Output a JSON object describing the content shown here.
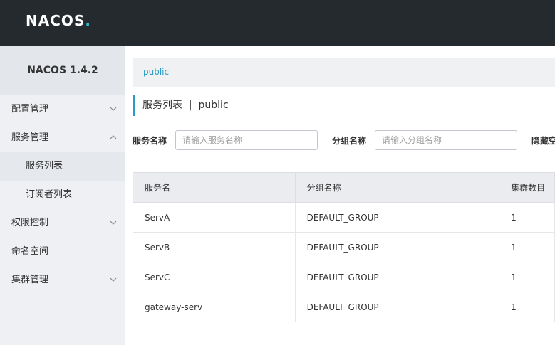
{
  "header": {
    "logo_main": "NACOS",
    "logo_dot": "."
  },
  "sidebar": {
    "brand": "NACOS 1.4.2",
    "items": [
      {
        "label": "配置管理",
        "chevron": "down"
      },
      {
        "label": "服务管理",
        "chevron": "up"
      },
      {
        "label": "服务列表",
        "sub": true,
        "active": true
      },
      {
        "label": "订阅者列表",
        "sub": true
      },
      {
        "label": "权限控制",
        "chevron": "down"
      },
      {
        "label": "命名空间"
      },
      {
        "label": "集群管理",
        "chevron": "down"
      }
    ]
  },
  "main": {
    "namespace_tab": "public",
    "title": "服务列表  |  public",
    "filters": {
      "service_label": "服务名称",
      "service_placeholder": "请输入服务名称",
      "group_label": "分组名称",
      "group_placeholder": "请输入分组名称",
      "hide_empty_label": "隐藏空"
    },
    "table": {
      "headers": [
        "服务名",
        "分组名称",
        "集群数目"
      ],
      "rows": [
        [
          "ServA",
          "DEFAULT_GROUP",
          "1"
        ],
        [
          "ServB",
          "DEFAULT_GROUP",
          "1"
        ],
        [
          "ServC",
          "DEFAULT_GROUP",
          "1"
        ],
        [
          "gateway-serv",
          "DEFAULT_GROUP",
          "1"
        ]
      ]
    }
  },
  "colors": {
    "accent": "#2a9cc4",
    "topbar": "#252a2f",
    "sidebar": "#eef0f3"
  }
}
